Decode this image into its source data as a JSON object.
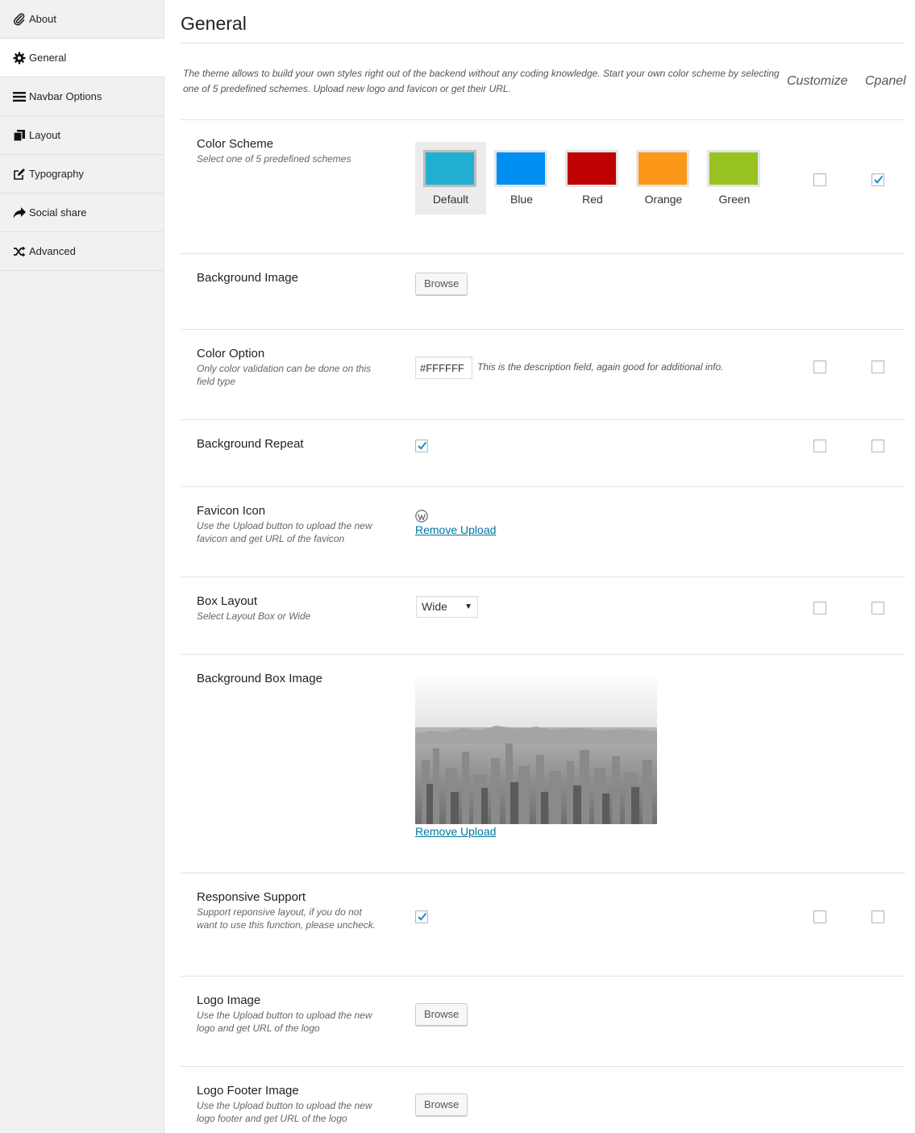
{
  "sidebar": {
    "items": [
      {
        "label": "About",
        "icon": "paperclip-icon"
      },
      {
        "label": "General",
        "icon": "gear-icon"
      },
      {
        "label": "Navbar Options",
        "icon": "hamburger-icon"
      },
      {
        "label": "Layout",
        "icon": "copy-icon"
      },
      {
        "label": "Typography",
        "icon": "edit-icon"
      },
      {
        "label": "Social share",
        "icon": "share-icon"
      },
      {
        "label": "Advanced",
        "icon": "shuffle-icon"
      }
    ],
    "active_index": 1
  },
  "header": {
    "title": "General",
    "intro": "The theme allows to build your own styles right out of the backend without any coding knowledge. Start your own color scheme by selecting one of 5 predefined schemes. Upload new logo and favicon or get their URL.",
    "col_customize": "Customize",
    "col_cpanel": "Cpanel"
  },
  "fields": {
    "color_scheme": {
      "label": "Color Scheme",
      "desc": "Select one of 5 predefined schemes",
      "selected": "Default",
      "schemes": [
        {
          "name": "Default",
          "color": "#22aed1"
        },
        {
          "name": "Blue",
          "color": "#008ef2"
        },
        {
          "name": "Red",
          "color": "#bf0000"
        },
        {
          "name": "Orange",
          "color": "#fc9819"
        },
        {
          "name": "Green",
          "color": "#99c322"
        }
      ],
      "customize": false,
      "cpanel": true
    },
    "background_image": {
      "label": "Background Image",
      "button": "Browse"
    },
    "color_option": {
      "label": "Color Option",
      "desc": "Only color validation can be done on this field type",
      "value": "#FFFFFF",
      "help": "This is the description field, again good for additional info.",
      "customize": false,
      "cpanel": false
    },
    "background_repeat": {
      "label": "Background Repeat",
      "checked": true,
      "customize": false,
      "cpanel": false
    },
    "favicon_icon": {
      "label": "Favicon Icon",
      "desc": "Use the Upload button to upload the new favicon and get URL of the favicon",
      "icon": "wordpress-icon",
      "remove": "Remove Upload"
    },
    "box_layout": {
      "label": "Box Layout",
      "desc": "Select Layout Box or Wide",
      "value": "Wide",
      "customize": false,
      "cpanel": false
    },
    "background_box_image": {
      "label": "Background Box Image",
      "remove": "Remove Upload"
    },
    "responsive_support": {
      "label": "Responsive Support",
      "desc": "Support reponsive layout, if you do not want to use this function, please uncheck.",
      "checked": true,
      "customize": false,
      "cpanel": false
    },
    "logo_image": {
      "label": "Logo Image",
      "desc": "Use the Upload button to upload the new logo and get URL of the logo",
      "button": "Browse"
    },
    "logo_footer_image": {
      "label": "Logo Footer Image",
      "desc": "Use the Upload button to upload the new logo footer and get URL of the logo",
      "button": "Browse"
    }
  },
  "colors": {
    "accent_check": "#1e8cbe",
    "link": "#0074a2"
  }
}
